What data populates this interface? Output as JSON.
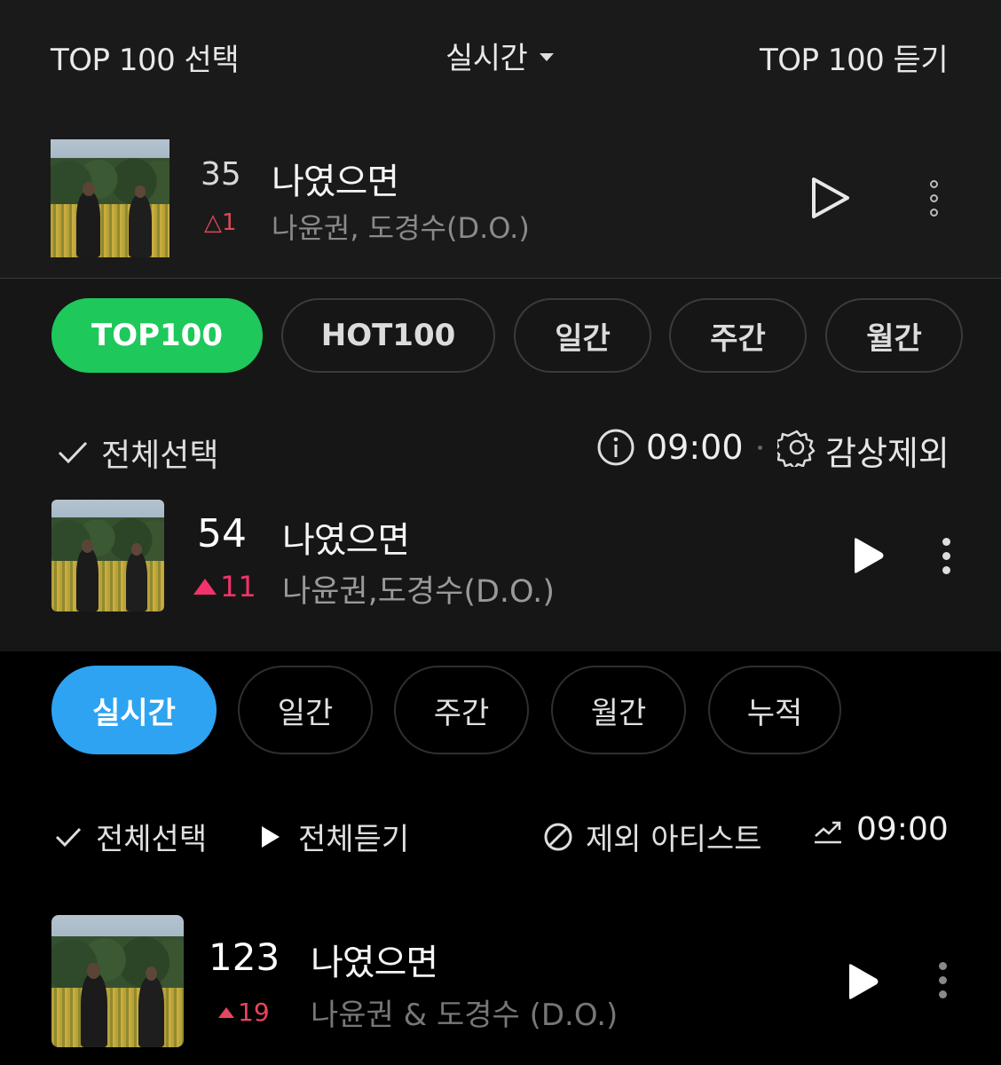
{
  "melon": {
    "left": "TOP 100 선택",
    "center": "실시간",
    "right": "TOP 100 듣기",
    "song": {
      "rank": "35",
      "change": "△1",
      "title": "나였으면",
      "artist": "나윤권, 도경수(D.O.)"
    }
  },
  "genie": {
    "tabs": [
      "TOP100",
      "HOT100",
      "일간",
      "주간",
      "월간"
    ],
    "select_all": "전체선택",
    "time": "09:00",
    "exclude": "감상제외",
    "song": {
      "rank": "54",
      "change": "11",
      "title": "나였으면",
      "artist": "나윤권,도경수(D.O.)"
    }
  },
  "flo": {
    "tabs": [
      "실시간",
      "일간",
      "주간",
      "월간",
      "누적"
    ],
    "select_all": "전체선택",
    "play_all": "전체듣기",
    "exclude_artist": "제외 아티스트",
    "time": "09:00",
    "song": {
      "rank": "123",
      "change": "19",
      "title": "나였으면",
      "artist": "나윤권 & 도경수 (D.O.)"
    }
  },
  "colors": {
    "green": "#1ec85a",
    "blue": "#2ea3f2",
    "up_red": "#f0336a",
    "panel1_bg": "#1a1a1a"
  }
}
